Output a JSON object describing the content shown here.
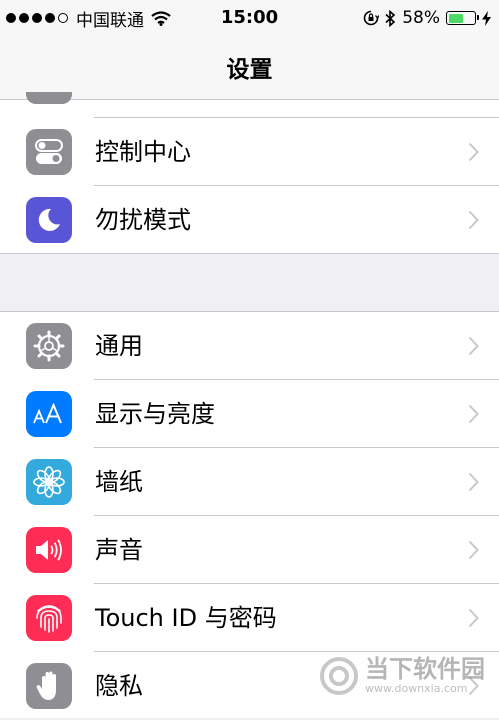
{
  "status_bar": {
    "carrier": "中国联通",
    "time": "15:00",
    "battery_percent": "58%",
    "battery_level": 0.58
  },
  "nav": {
    "title": "设置"
  },
  "groups": [
    {
      "items": [
        {
          "label": "控制中心",
          "icon": "control-center-icon",
          "color": "#8e8e93"
        },
        {
          "label": "勿扰模式",
          "icon": "moon-icon",
          "color": "#5856d6"
        }
      ]
    },
    {
      "items": [
        {
          "label": "通用",
          "icon": "gear-icon",
          "color": "#8e8e93"
        },
        {
          "label": "显示与亮度",
          "icon": "text-size-icon",
          "color": "#007aff"
        },
        {
          "label": "墙纸",
          "icon": "flower-icon",
          "color": "#34aadc"
        },
        {
          "label": "声音",
          "icon": "speaker-icon",
          "color": "#ff2d55"
        },
        {
          "label": "Touch ID 与密码",
          "icon": "fingerprint-icon",
          "color": "#ff2d55"
        },
        {
          "label": "隐私",
          "icon": "hand-icon",
          "color": "#8e8e93"
        }
      ]
    }
  ],
  "watermark": {
    "name": "当下软件园",
    "url": "www.downxia.com"
  }
}
